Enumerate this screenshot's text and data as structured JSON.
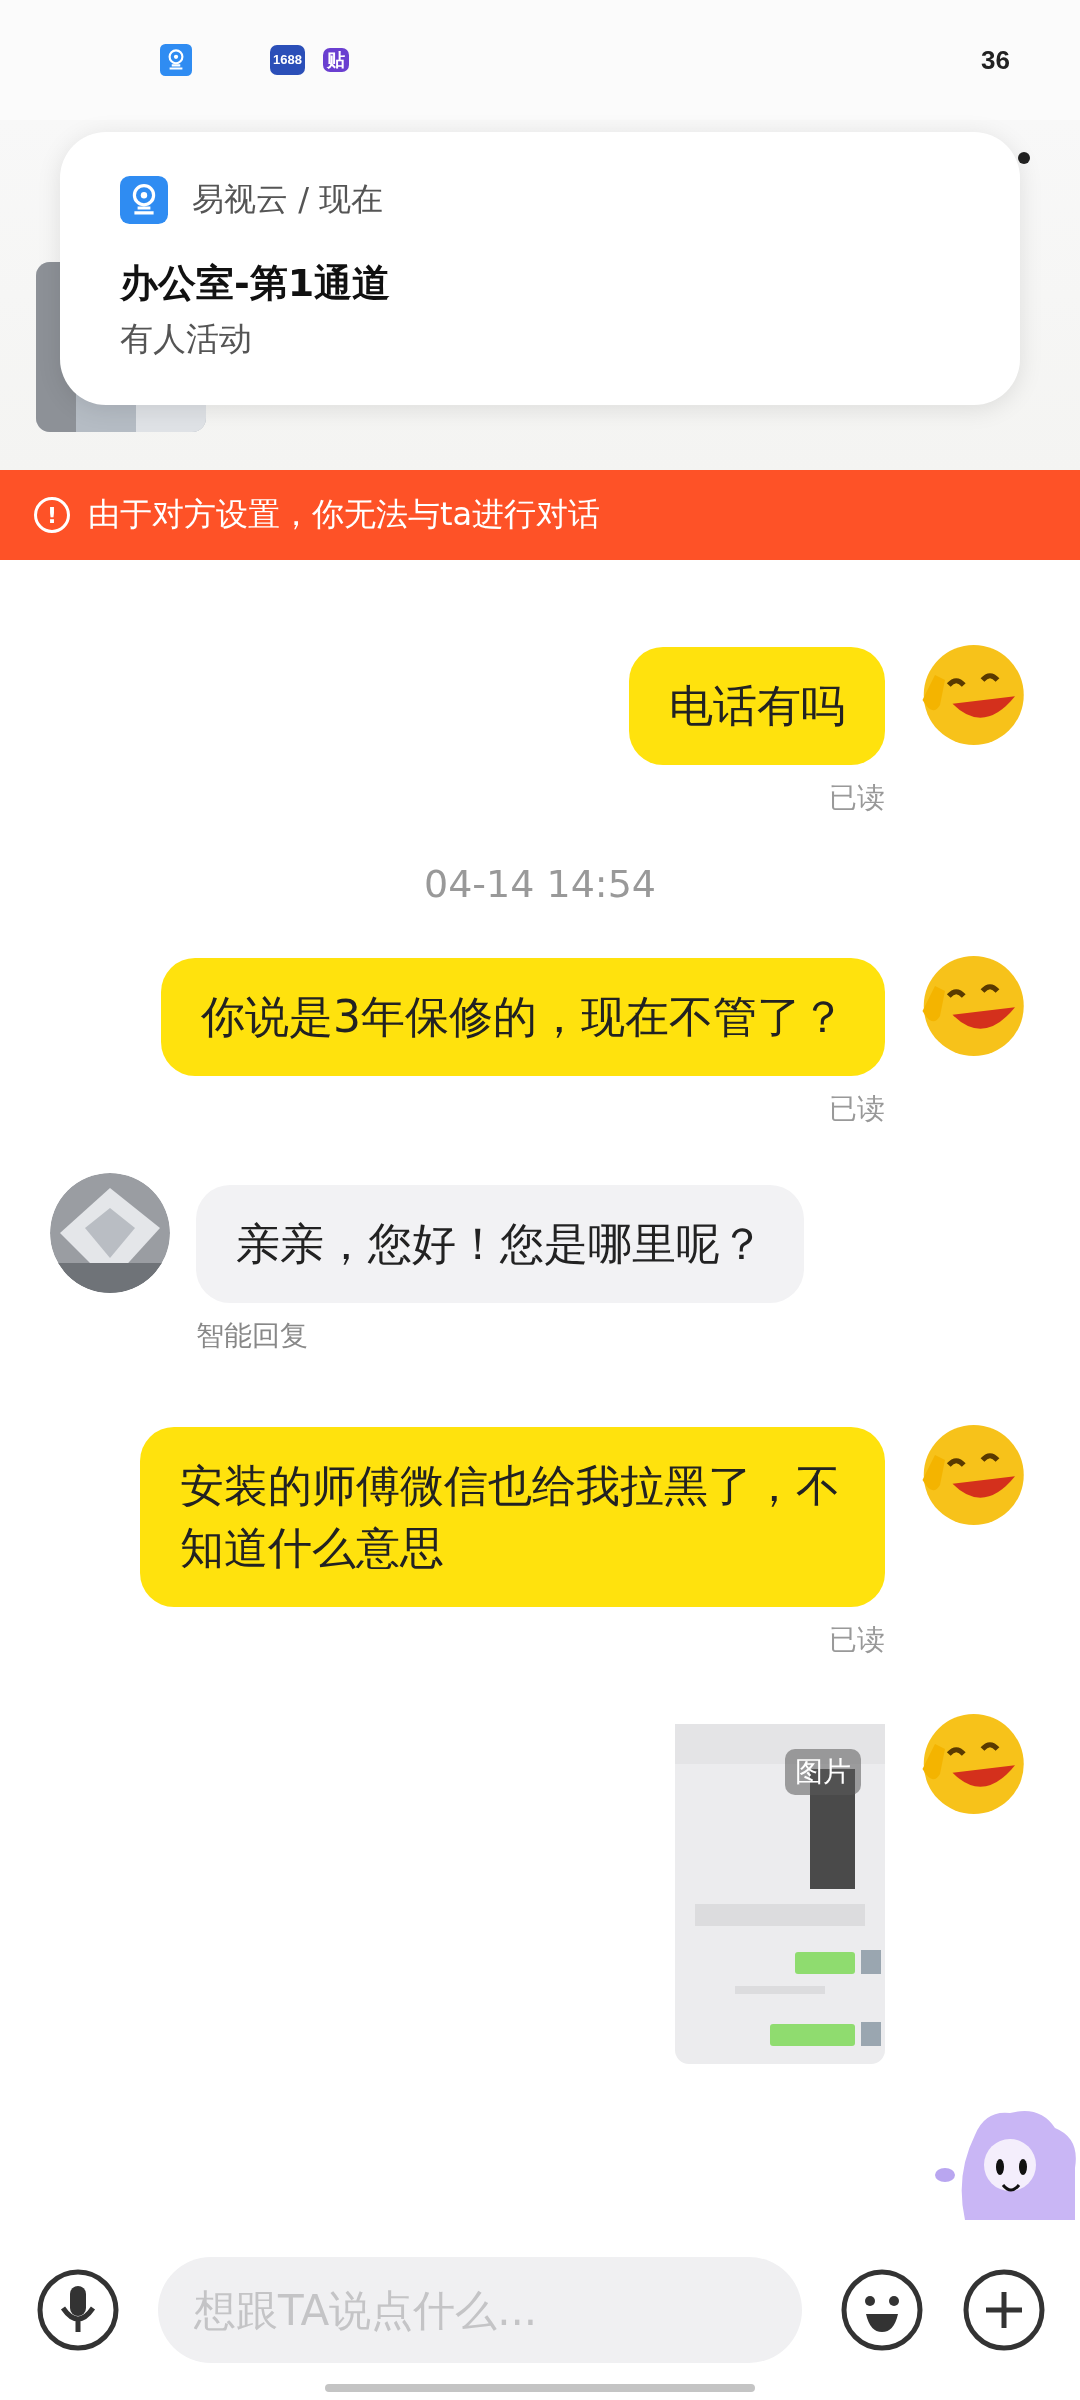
{
  "status_bar": {
    "app_icons": [
      {
        "kind": "camera"
      },
      {
        "kind": "text",
        "text": "1688"
      },
      {
        "kind": "text",
        "text": "贴"
      }
    ],
    "battery": "36"
  },
  "notification": {
    "app": "易视云 / 现在",
    "title": "办公室-第1通道",
    "body": "有人活动"
  },
  "banner": {
    "icon": "!",
    "text": "由于对方设置，你无法与ta进行对话"
  },
  "messages": [
    {
      "kind": "sent",
      "text": "电话有吗",
      "status": "已读"
    },
    {
      "kind": "timestamp",
      "text": "04-14 14:54"
    },
    {
      "kind": "sent",
      "text": "你说是3年保修的，现在不管了？",
      "status": "已读"
    },
    {
      "kind": "received",
      "text": "亲亲，您好！您是哪里呢？",
      "note": "智能回复"
    },
    {
      "kind": "sent",
      "text": "安装的师傅微信也给我拉黑了，不知道什么意思",
      "status": "已读"
    },
    {
      "label": "图片"
    }
  ],
  "input": {
    "placeholder": "想跟TA说点什么..."
  }
}
